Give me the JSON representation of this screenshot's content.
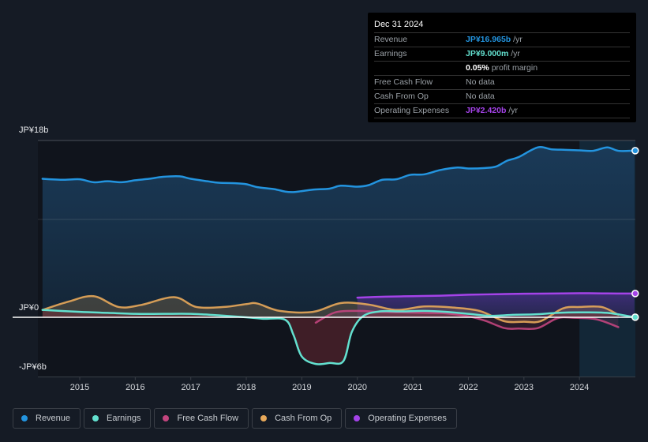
{
  "tooltip": {
    "date": "Dec 31 2024",
    "rows": [
      {
        "label": "Revenue",
        "value": "JP¥16.965b",
        "suffix": " /yr",
        "color": "#2394df"
      },
      {
        "label": "Earnings",
        "value": "JP¥9.000m",
        "suffix": " /yr",
        "color": "#63e0cf"
      },
      {
        "label": "",
        "value": "0.05%",
        "suffix": " profit margin",
        "color": "#ffffff"
      },
      {
        "label": "Free Cash Flow",
        "value": "",
        "suffix": "No data",
        "color": "#9aa0a6"
      },
      {
        "label": "Cash From Op",
        "value": "",
        "suffix": "No data",
        "color": "#9aa0a6"
      },
      {
        "label": "Operating Expenses",
        "value": "JP¥2.420b",
        "suffix": " /yr",
        "color": "#a443e8"
      }
    ]
  },
  "legend": [
    {
      "label": "Revenue",
      "color": "#2394df"
    },
    {
      "label": "Earnings",
      "color": "#63e0cf"
    },
    {
      "label": "Free Cash Flow",
      "color": "#c2457e"
    },
    {
      "label": "Cash From Op",
      "color": "#e8a95a"
    },
    {
      "label": "Operating Expenses",
      "color": "#a443e8"
    }
  ],
  "chart_data": {
    "type": "area",
    "title": "",
    "xlabel": "",
    "ylabel": "",
    "ylim": [
      -6,
      18
    ],
    "xlim": [
      2013.7,
      2025.0
    ],
    "y_ticks": [
      {
        "value": 18,
        "label": "JP¥18b"
      },
      {
        "value": 0,
        "label": "JP¥0"
      },
      {
        "value": -6,
        "label": "-JP¥6b"
      }
    ],
    "x_ticks": [
      "2015",
      "2016",
      "2017",
      "2018",
      "2019",
      "2020",
      "2021",
      "2022",
      "2023",
      "2024"
    ],
    "x_tick_values": [
      2015,
      2016,
      2017,
      2018,
      2019,
      2020,
      2021,
      2022,
      2023,
      2024
    ],
    "forecast_region_start": 2024.0,
    "series": [
      {
        "name": "Revenue",
        "color": "#2394df",
        "points": [
          [
            2014.33,
            14.1
          ],
          [
            2014.7,
            14.0
          ],
          [
            2015.0,
            14.05
          ],
          [
            2015.25,
            13.75
          ],
          [
            2015.5,
            13.85
          ],
          [
            2015.75,
            13.75
          ],
          [
            2016.0,
            13.95
          ],
          [
            2016.25,
            14.1
          ],
          [
            2016.5,
            14.3
          ],
          [
            2016.8,
            14.35
          ],
          [
            2017.0,
            14.1
          ],
          [
            2017.3,
            13.85
          ],
          [
            2017.5,
            13.7
          ],
          [
            2017.8,
            13.65
          ],
          [
            2018.0,
            13.55
          ],
          [
            2018.2,
            13.25
          ],
          [
            2018.5,
            13.05
          ],
          [
            2018.7,
            12.8
          ],
          [
            2018.85,
            12.75
          ],
          [
            2019.0,
            12.85
          ],
          [
            2019.2,
            13.0
          ],
          [
            2019.5,
            13.1
          ],
          [
            2019.7,
            13.4
          ],
          [
            2020.0,
            13.3
          ],
          [
            2020.2,
            13.45
          ],
          [
            2020.45,
            14.0
          ],
          [
            2020.7,
            14.05
          ],
          [
            2020.95,
            14.5
          ],
          [
            2021.2,
            14.55
          ],
          [
            2021.5,
            15.0
          ],
          [
            2021.8,
            15.25
          ],
          [
            2022.0,
            15.15
          ],
          [
            2022.3,
            15.2
          ],
          [
            2022.5,
            15.35
          ],
          [
            2022.7,
            15.95
          ],
          [
            2022.9,
            16.3
          ],
          [
            2023.25,
            17.3
          ],
          [
            2023.5,
            17.1
          ],
          [
            2023.75,
            17.05
          ],
          [
            2024.0,
            17.0
          ],
          [
            2024.25,
            16.95
          ],
          [
            2024.5,
            17.3
          ],
          [
            2024.7,
            16.95
          ],
          [
            2024.99,
            16.965
          ]
        ]
      },
      {
        "name": "Earnings",
        "color": "#63e0cf",
        "points": [
          [
            2014.33,
            0.75
          ],
          [
            2015.0,
            0.55
          ],
          [
            2015.5,
            0.45
          ],
          [
            2016.0,
            0.35
          ],
          [
            2016.5,
            0.35
          ],
          [
            2017.0,
            0.35
          ],
          [
            2017.5,
            0.2
          ],
          [
            2018.0,
            0.0
          ],
          [
            2018.3,
            -0.15
          ],
          [
            2018.7,
            -0.25
          ],
          [
            2018.85,
            -1.8
          ],
          [
            2019.0,
            -4.0
          ],
          [
            2019.25,
            -4.75
          ],
          [
            2019.5,
            -4.65
          ],
          [
            2019.75,
            -4.45
          ],
          [
            2019.9,
            -1.5
          ],
          [
            2020.1,
            0.1
          ],
          [
            2020.4,
            0.6
          ],
          [
            2020.8,
            0.6
          ],
          [
            2021.2,
            0.65
          ],
          [
            2021.6,
            0.55
          ],
          [
            2022.0,
            0.35
          ],
          [
            2022.4,
            0.15
          ],
          [
            2022.8,
            0.25
          ],
          [
            2023.2,
            0.3
          ],
          [
            2023.6,
            0.45
          ],
          [
            2024.0,
            0.5
          ],
          [
            2024.5,
            0.45
          ],
          [
            2024.99,
            0.009
          ]
        ]
      },
      {
        "name": "Free Cash Flow",
        "color": "#c2457e",
        "points": [
          [
            2019.25,
            -0.55
          ],
          [
            2019.6,
            0.5
          ],
          [
            2020.0,
            0.65
          ],
          [
            2020.4,
            0.55
          ],
          [
            2020.8,
            0.5
          ],
          [
            2021.2,
            0.45
          ],
          [
            2021.6,
            0.4
          ],
          [
            2022.0,
            0.1
          ],
          [
            2022.3,
            -0.35
          ],
          [
            2022.65,
            -1.1
          ],
          [
            2022.9,
            -1.15
          ],
          [
            2023.25,
            -1.1
          ],
          [
            2023.6,
            -0.1
          ],
          [
            2023.9,
            -0.05
          ],
          [
            2024.3,
            -0.2
          ],
          [
            2024.7,
            -1.0
          ]
        ]
      },
      {
        "name": "Cash From Op",
        "color": "#e8a95a",
        "points": [
          [
            2014.33,
            0.75
          ],
          [
            2014.8,
            1.6
          ],
          [
            2015.25,
            2.15
          ],
          [
            2015.7,
            1.05
          ],
          [
            2016.1,
            1.25
          ],
          [
            2016.7,
            2.05
          ],
          [
            2017.1,
            1.05
          ],
          [
            2017.6,
            1.05
          ],
          [
            2018.0,
            1.35
          ],
          [
            2018.2,
            1.4
          ],
          [
            2018.6,
            0.65
          ],
          [
            2019.2,
            0.55
          ],
          [
            2019.7,
            1.45
          ],
          [
            2020.2,
            1.3
          ],
          [
            2020.7,
            0.75
          ],
          [
            2021.2,
            1.1
          ],
          [
            2021.7,
            1.0
          ],
          [
            2022.2,
            0.65
          ],
          [
            2022.65,
            -0.4
          ],
          [
            2023.0,
            -0.45
          ],
          [
            2023.3,
            -0.4
          ],
          [
            2023.7,
            0.9
          ],
          [
            2024.0,
            1.05
          ],
          [
            2024.4,
            1.05
          ],
          [
            2024.7,
            0.25
          ]
        ]
      },
      {
        "name": "Operating Expenses",
        "color": "#a443e8",
        "points": [
          [
            2020.0,
            2.0
          ],
          [
            2020.5,
            2.1
          ],
          [
            2021.0,
            2.15
          ],
          [
            2021.5,
            2.2
          ],
          [
            2022.0,
            2.3
          ],
          [
            2022.5,
            2.35
          ],
          [
            2023.0,
            2.4
          ],
          [
            2023.5,
            2.42
          ],
          [
            2024.0,
            2.45
          ],
          [
            2024.5,
            2.43
          ],
          [
            2024.99,
            2.42
          ]
        ]
      }
    ]
  }
}
